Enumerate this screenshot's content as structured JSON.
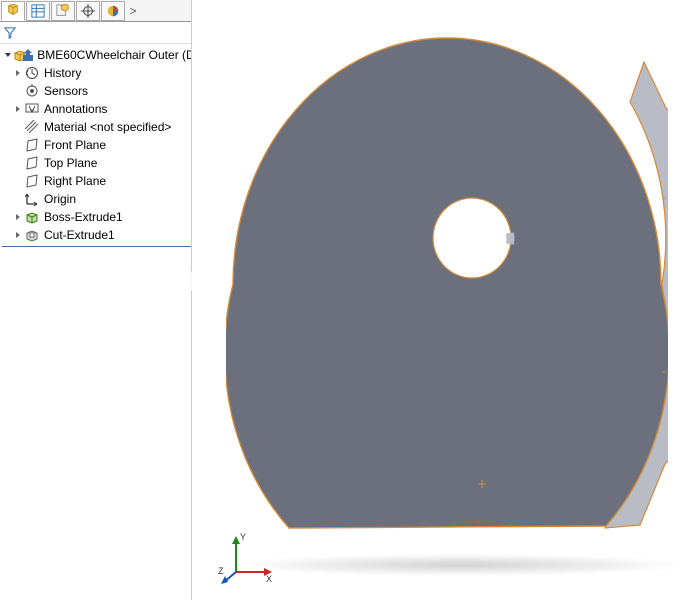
{
  "tabs": {
    "overflow_glyph": ">"
  },
  "tree": {
    "root": "BME60CWheelchair Outer  (D",
    "items": [
      {
        "label": "History",
        "icon": "history",
        "has_children": true
      },
      {
        "label": "Sensors",
        "icon": "sensors",
        "has_children": false
      },
      {
        "label": "Annotations",
        "icon": "annotations",
        "has_children": true
      },
      {
        "label": "Material <not specified>",
        "icon": "material",
        "has_children": false
      },
      {
        "label": "Front Plane",
        "icon": "plane",
        "has_children": false
      },
      {
        "label": "Top Plane",
        "icon": "plane",
        "has_children": false
      },
      {
        "label": "Right Plane",
        "icon": "plane",
        "has_children": false
      },
      {
        "label": "Origin",
        "icon": "origin",
        "has_children": false
      },
      {
        "label": "Boss-Extrude1",
        "icon": "extrude",
        "has_children": true
      },
      {
        "label": "Cut-Extrude1",
        "icon": "cut",
        "has_children": true
      }
    ]
  },
  "triad": {
    "x": "X",
    "y": "Y",
    "z": "Z"
  },
  "colors": {
    "part_face": "#6b707c",
    "part_side": "#b9bcc5",
    "part_edge": "#d38a3a",
    "tree_rule": "#3b6ea5"
  }
}
